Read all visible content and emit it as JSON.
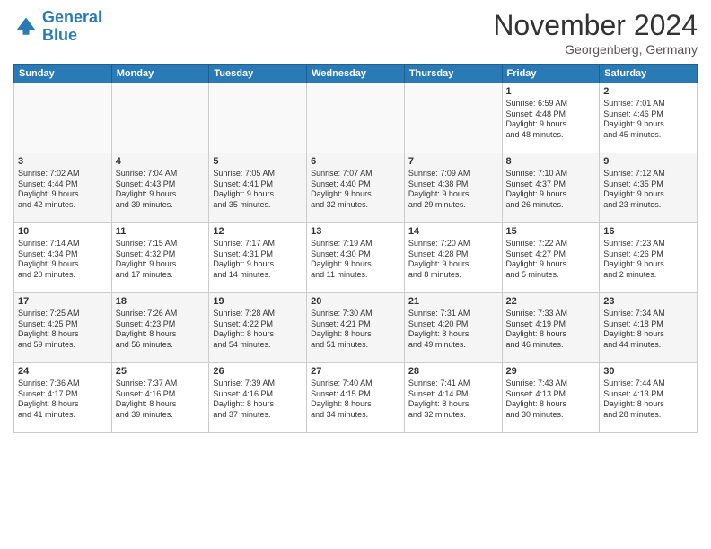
{
  "header": {
    "logo_line1": "General",
    "logo_line2": "Blue",
    "month_title": "November 2024",
    "subtitle": "Georgenberg, Germany"
  },
  "weekdays": [
    "Sunday",
    "Monday",
    "Tuesday",
    "Wednesday",
    "Thursday",
    "Friday",
    "Saturday"
  ],
  "weeks": [
    [
      {
        "day": "",
        "info": ""
      },
      {
        "day": "",
        "info": ""
      },
      {
        "day": "",
        "info": ""
      },
      {
        "day": "",
        "info": ""
      },
      {
        "day": "",
        "info": ""
      },
      {
        "day": "1",
        "info": "Sunrise: 6:59 AM\nSunset: 4:48 PM\nDaylight: 9 hours\nand 48 minutes."
      },
      {
        "day": "2",
        "info": "Sunrise: 7:01 AM\nSunset: 4:46 PM\nDaylight: 9 hours\nand 45 minutes."
      }
    ],
    [
      {
        "day": "3",
        "info": "Sunrise: 7:02 AM\nSunset: 4:44 PM\nDaylight: 9 hours\nand 42 minutes."
      },
      {
        "day": "4",
        "info": "Sunrise: 7:04 AM\nSunset: 4:43 PM\nDaylight: 9 hours\nand 39 minutes."
      },
      {
        "day": "5",
        "info": "Sunrise: 7:05 AM\nSunset: 4:41 PM\nDaylight: 9 hours\nand 35 minutes."
      },
      {
        "day": "6",
        "info": "Sunrise: 7:07 AM\nSunset: 4:40 PM\nDaylight: 9 hours\nand 32 minutes."
      },
      {
        "day": "7",
        "info": "Sunrise: 7:09 AM\nSunset: 4:38 PM\nDaylight: 9 hours\nand 29 minutes."
      },
      {
        "day": "8",
        "info": "Sunrise: 7:10 AM\nSunset: 4:37 PM\nDaylight: 9 hours\nand 26 minutes."
      },
      {
        "day": "9",
        "info": "Sunrise: 7:12 AM\nSunset: 4:35 PM\nDaylight: 9 hours\nand 23 minutes."
      }
    ],
    [
      {
        "day": "10",
        "info": "Sunrise: 7:14 AM\nSunset: 4:34 PM\nDaylight: 9 hours\nand 20 minutes."
      },
      {
        "day": "11",
        "info": "Sunrise: 7:15 AM\nSunset: 4:32 PM\nDaylight: 9 hours\nand 17 minutes."
      },
      {
        "day": "12",
        "info": "Sunrise: 7:17 AM\nSunset: 4:31 PM\nDaylight: 9 hours\nand 14 minutes."
      },
      {
        "day": "13",
        "info": "Sunrise: 7:19 AM\nSunset: 4:30 PM\nDaylight: 9 hours\nand 11 minutes."
      },
      {
        "day": "14",
        "info": "Sunrise: 7:20 AM\nSunset: 4:28 PM\nDaylight: 9 hours\nand 8 minutes."
      },
      {
        "day": "15",
        "info": "Sunrise: 7:22 AM\nSunset: 4:27 PM\nDaylight: 9 hours\nand 5 minutes."
      },
      {
        "day": "16",
        "info": "Sunrise: 7:23 AM\nSunset: 4:26 PM\nDaylight: 9 hours\nand 2 minutes."
      }
    ],
    [
      {
        "day": "17",
        "info": "Sunrise: 7:25 AM\nSunset: 4:25 PM\nDaylight: 8 hours\nand 59 minutes."
      },
      {
        "day": "18",
        "info": "Sunrise: 7:26 AM\nSunset: 4:23 PM\nDaylight: 8 hours\nand 56 minutes."
      },
      {
        "day": "19",
        "info": "Sunrise: 7:28 AM\nSunset: 4:22 PM\nDaylight: 8 hours\nand 54 minutes."
      },
      {
        "day": "20",
        "info": "Sunrise: 7:30 AM\nSunset: 4:21 PM\nDaylight: 8 hours\nand 51 minutes."
      },
      {
        "day": "21",
        "info": "Sunrise: 7:31 AM\nSunset: 4:20 PM\nDaylight: 8 hours\nand 49 minutes."
      },
      {
        "day": "22",
        "info": "Sunrise: 7:33 AM\nSunset: 4:19 PM\nDaylight: 8 hours\nand 46 minutes."
      },
      {
        "day": "23",
        "info": "Sunrise: 7:34 AM\nSunset: 4:18 PM\nDaylight: 8 hours\nand 44 minutes."
      }
    ],
    [
      {
        "day": "24",
        "info": "Sunrise: 7:36 AM\nSunset: 4:17 PM\nDaylight: 8 hours\nand 41 minutes."
      },
      {
        "day": "25",
        "info": "Sunrise: 7:37 AM\nSunset: 4:16 PM\nDaylight: 8 hours\nand 39 minutes."
      },
      {
        "day": "26",
        "info": "Sunrise: 7:39 AM\nSunset: 4:16 PM\nDaylight: 8 hours\nand 37 minutes."
      },
      {
        "day": "27",
        "info": "Sunrise: 7:40 AM\nSunset: 4:15 PM\nDaylight: 8 hours\nand 34 minutes."
      },
      {
        "day": "28",
        "info": "Sunrise: 7:41 AM\nSunset: 4:14 PM\nDaylight: 8 hours\nand 32 minutes."
      },
      {
        "day": "29",
        "info": "Sunrise: 7:43 AM\nSunset: 4:13 PM\nDaylight: 8 hours\nand 30 minutes."
      },
      {
        "day": "30",
        "info": "Sunrise: 7:44 AM\nSunset: 4:13 PM\nDaylight: 8 hours\nand 28 minutes."
      }
    ]
  ]
}
